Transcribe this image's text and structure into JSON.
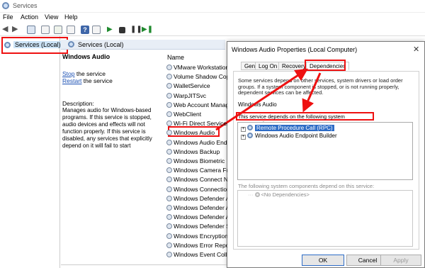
{
  "window": {
    "title": "Services"
  },
  "menu": [
    "File",
    "Action",
    "View",
    "Help"
  ],
  "left_pane": {
    "item": "Services (Local)"
  },
  "middle": {
    "header": "Services (Local)",
    "service_title": "Windows Audio",
    "stop_link": "Stop",
    "stop_rest": " the service",
    "restart_link": "Restart",
    "restart_rest": " the service",
    "description_label": "Description:",
    "description": "Manages audio for Windows-based programs.  If this service is stopped, audio devices and effects will not function properly.  If this service is disabled, any services that explicitly depend on it will fail to start",
    "name_header": "Name",
    "services": [
      "VMware Workstation",
      "Volume Shadow Copy",
      "WalletService",
      "WarpJITSvc",
      "Web Account Manager",
      "WebClient",
      "Wi-Fi Direct Services",
      "Windows Audio",
      "Windows Audio Endpoint",
      "Windows Backup",
      "Windows Biometric",
      "Windows Camera Fr",
      "Windows Connect N",
      "Windows Connection",
      "Windows Defender A",
      "Windows Defender A",
      "Windows Defender A",
      "Windows Defender S",
      "Windows Encryption",
      "Windows Error Repor",
      "Windows Event Colle"
    ]
  },
  "dialog": {
    "title": "Windows Audio Properties (Local Computer)",
    "tabs": [
      "General",
      "Log On",
      "Recovery",
      "Dependencies"
    ],
    "intro": "Some services depend on other services, system drivers or load order groups. If a system component is stopped, or is not running properly, dependent services can be affected.",
    "service_name": "Windows Audio",
    "depends_label": "This service depends on the following system components:",
    "depends_on": [
      "Remote Procedure Call (RPC)",
      "Windows Audio Endpoint Builder"
    ],
    "dependents_label": "The following system components depend on this service:",
    "dependents": [
      "<No Dependencies>"
    ],
    "buttons": {
      "ok": "OK",
      "cancel": "Cancel",
      "apply": "Apply"
    }
  },
  "colors": {
    "highlight": "#e11111",
    "selection": "#2d6cc6"
  }
}
